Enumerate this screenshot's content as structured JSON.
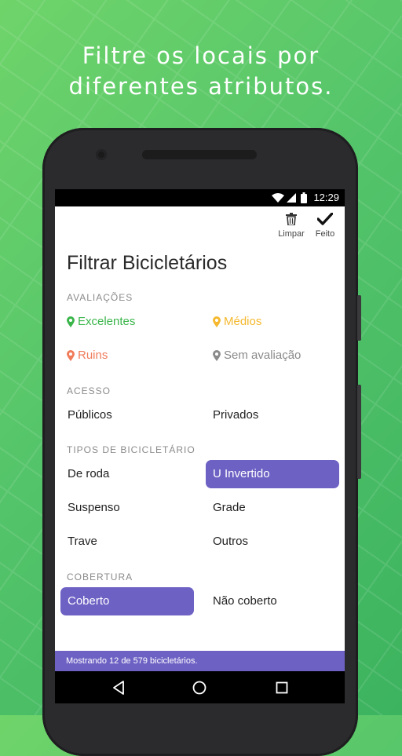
{
  "headline": {
    "line1": "Filtre os locais por",
    "line2": "diferentes atributos."
  },
  "status": {
    "time": "12:29"
  },
  "toolbar": {
    "clear_label": "Limpar",
    "done_label": "Feito"
  },
  "page_title": "Filtrar Bicicletários",
  "sections": {
    "ratings": {
      "title": "AVALIAÇÕES",
      "excellent": "Excelentes",
      "medium": "Médios",
      "bad": "Ruins",
      "unrated": "Sem avaliação"
    },
    "access": {
      "title": "ACESSO",
      "public": "Públicos",
      "private": "Privados"
    },
    "types": {
      "title": "TIPOS DE BICICLETÁRIO",
      "wheel": "De roda",
      "inverted_u": "U Invertido",
      "suspended": "Suspenso",
      "grid": "Grade",
      "trave": "Trave",
      "others": "Outros"
    },
    "cover": {
      "title": "COBERTURA",
      "covered": "Coberto",
      "uncovered": "Não coberto"
    }
  },
  "selected": [
    "U Invertido",
    "Coberto"
  ],
  "footer": {
    "status_text": "Mostrando 12 de 579 bicicletários."
  },
  "colors": {
    "accent": "#6d61c4",
    "excellent": "#3ab54a",
    "medium": "#f5b82e",
    "bad": "#f07c5a",
    "unrated": "#8a8a8a",
    "background": "#4fc066"
  }
}
